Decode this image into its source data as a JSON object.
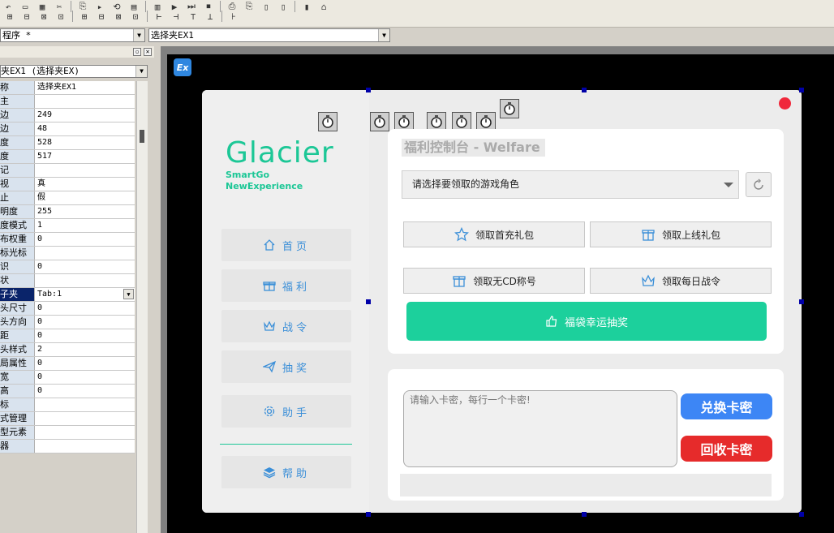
{
  "toolbar": {
    "row1": [
      "↶",
      "▭",
      "▦",
      "✂",
      "⎘",
      "▸",
      "⟲",
      "▤",
      "▥",
      "▶",
      "⏭",
      "⏹",
      "⎙",
      "⎘",
      "▯",
      "▯",
      "▮",
      "⌂"
    ],
    "row2": [
      "⊞",
      "⊟",
      "⊠",
      "⊡",
      "⊞",
      "⊟",
      "⊠",
      "⊡",
      "⊢",
      "⊣",
      "⊤",
      "⊥",
      "⊦"
    ]
  },
  "combos": {
    "program": "程序 *",
    "object": "选择夹EX1"
  },
  "properties": {
    "selector": "夹EX1 (选择夹EX)",
    "rows": [
      {
        "key": "称",
        "value": "选择夹EX1"
      },
      {
        "key": "主",
        "value": ""
      },
      {
        "key": "边",
        "value": "249"
      },
      {
        "key": "边",
        "value": "48"
      },
      {
        "key": "度",
        "value": "528"
      },
      {
        "key": "度",
        "value": "517"
      },
      {
        "key": "记",
        "value": ""
      },
      {
        "key": "视",
        "value": "真"
      },
      {
        "key": "止",
        "value": "假"
      },
      {
        "key": "明度",
        "value": "255"
      },
      {
        "key": "度模式",
        "value": "1"
      },
      {
        "key": "布权重",
        "value": "0"
      },
      {
        "key": "标光标",
        "value": ""
      },
      {
        "key": "识",
        "value": "0"
      },
      {
        "key": "状",
        "value": ""
      },
      {
        "key": "子夹",
        "value": "Tab:1",
        "selected": true
      },
      {
        "key": "头尺寸",
        "value": "0"
      },
      {
        "key": "头方向",
        "value": "0"
      },
      {
        "key": "距",
        "value": "0"
      },
      {
        "key": "头样式",
        "value": "2"
      },
      {
        "key": "局属性",
        "value": "0"
      },
      {
        "key": "宽",
        "value": "0"
      },
      {
        "key": "高",
        "value": "0"
      },
      {
        "key": "标",
        "value": ""
      },
      {
        "key": "式管理",
        "value": ""
      },
      {
        "key": "型元素",
        "value": ""
      },
      {
        "key": "器",
        "value": ""
      }
    ]
  },
  "canvas": {
    "badge": "Ex"
  },
  "app": {
    "brand": {
      "title": "Glacier",
      "sub1": "SmartGo",
      "sub2": "NewExperience"
    },
    "nav": [
      {
        "label": "首页",
        "icon": "home-icon"
      },
      {
        "label": "福利",
        "icon": "gift-icon"
      },
      {
        "label": "战令",
        "icon": "crown-icon"
      },
      {
        "label": "抽奖",
        "icon": "send-icon"
      },
      {
        "label": "助手",
        "icon": "gear-icon"
      },
      {
        "label": "帮助",
        "icon": "layers-icon"
      }
    ],
    "card_title": "福利控制台 - Welfare",
    "role_select": "请选择要领取的游戏角色",
    "actions": [
      {
        "label": "领取首充礼包",
        "icon": "star-icon"
      },
      {
        "label": "领取上线礼包",
        "icon": "gift-icon"
      },
      {
        "label": "领取无CD称号",
        "icon": "gift-icon"
      },
      {
        "label": "领取每日战令",
        "icon": "crown-icon"
      }
    ],
    "lottery": "福袋幸运抽奖",
    "cdkey_placeholder": "请输入卡密，每行一个卡密!",
    "exchange": "兑换卡密",
    "recycle": "回收卡密"
  },
  "colors": {
    "accent": "#1cc796",
    "nav_text": "#3b8fd8",
    "exchange": "#3d86f5",
    "recycle": "#e62b2b",
    "close": "#f0283b"
  }
}
